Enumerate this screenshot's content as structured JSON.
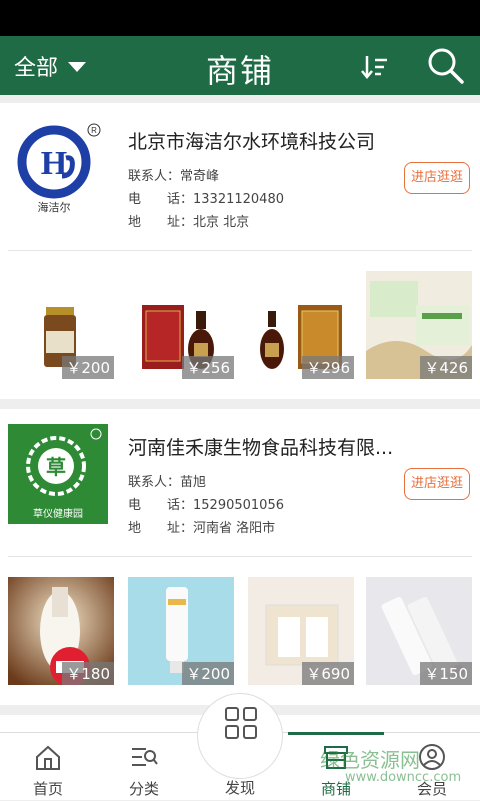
{
  "header": {
    "filter_label": "全部",
    "title": "商铺"
  },
  "shops": [
    {
      "name": "北京市海洁尔水环境科技公司",
      "contact_label": "联系人：",
      "contact": "常奇峰",
      "phone_label": "电　　话：",
      "phone": "13321120480",
      "address_label": "地　　址：",
      "address": "北京 北京",
      "enter_label": "进店逛逛",
      "logo_text": "海洁尔",
      "products": [
        {
          "price": "￥200"
        },
        {
          "price": "￥256"
        },
        {
          "price": "￥296"
        },
        {
          "price": "￥426"
        }
      ]
    },
    {
      "name": "河南佳禾康生物食品科技有限...",
      "contact_label": "联系人：",
      "contact": "苗旭",
      "phone_label": "电　　话：",
      "phone": "15290501056",
      "address_label": "地　　址：",
      "address": "河南省 洛阳市",
      "enter_label": "进店逛逛",
      "logo_text": "草仪健康园",
      "products": [
        {
          "price": "￥180"
        },
        {
          "price": "￥200"
        },
        {
          "price": "￥690"
        },
        {
          "price": "￥150"
        }
      ]
    }
  ],
  "tabbar": {
    "items": [
      {
        "label": "首页",
        "icon": "home-icon"
      },
      {
        "label": "分类",
        "icon": "category-icon"
      },
      {
        "label": "发现",
        "icon": "grid-icon"
      },
      {
        "label": "商铺",
        "icon": "store-icon"
      },
      {
        "label": "会员",
        "icon": "member-icon"
      }
    ],
    "active": "商铺"
  },
  "watermark": {
    "text": "绿色资源网",
    "url": "www.downcc.com"
  },
  "colors": {
    "brand": "#1f6b45",
    "accent": "#e8703d"
  }
}
